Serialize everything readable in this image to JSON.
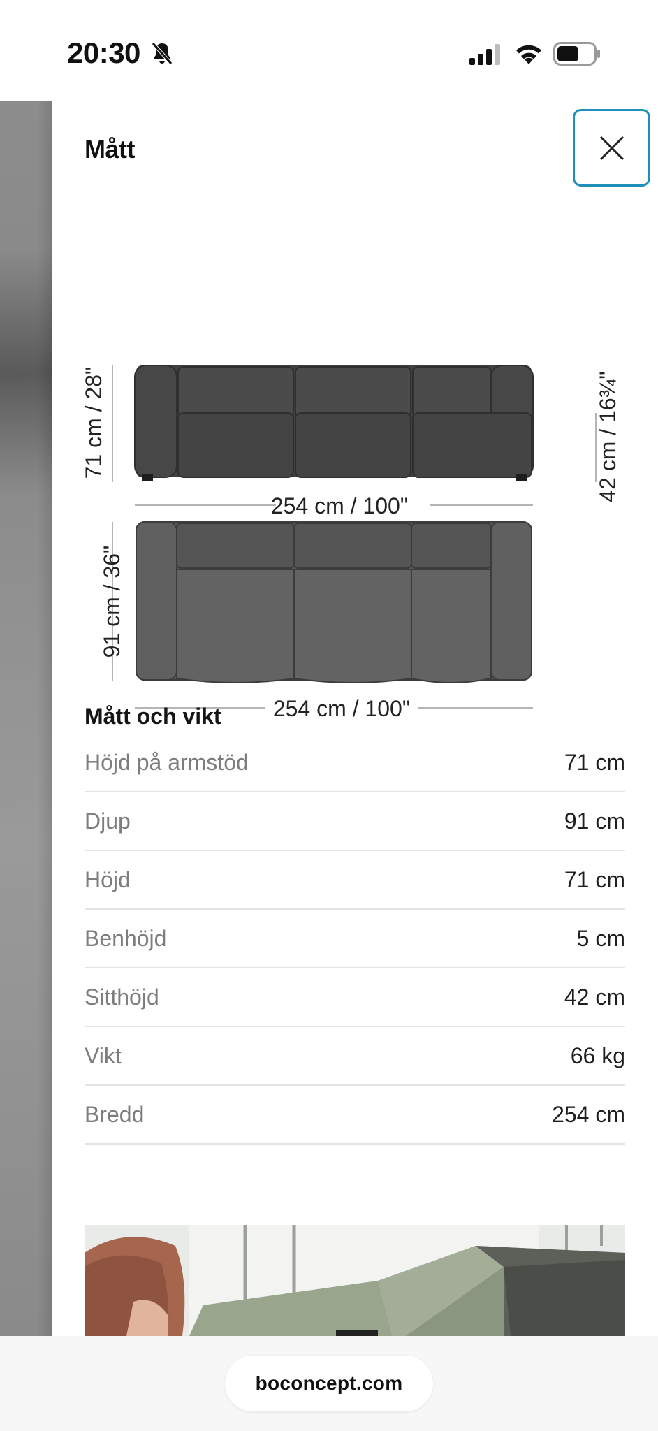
{
  "status_bar": {
    "time": "20:30",
    "icons": [
      "bell-slash-icon",
      "cellular-signal-icon",
      "wifi-icon",
      "battery-icon"
    ]
  },
  "panel": {
    "title": "Mått",
    "close_icon": "close-icon",
    "accent_color": "#1e8fb8"
  },
  "diagram": {
    "front_height": "71 cm / 28\"",
    "seat_height": "42 cm / 16¾\"",
    "front_width": "254 cm / 100\"",
    "top_depth": "91 cm / 36\"",
    "top_width": "254 cm / 100\"",
    "sofa_color": "#4a4a4a"
  },
  "specs": {
    "title": "Mått och vikt",
    "rows": [
      {
        "label": "Höjd på armstöd",
        "value": "71 cm"
      },
      {
        "label": "Djup",
        "value": "91 cm"
      },
      {
        "label": "Höjd",
        "value": "71 cm"
      },
      {
        "label": "Benhöjd",
        "value": "5 cm"
      },
      {
        "label": "Sitthöjd",
        "value": "42 cm"
      },
      {
        "label": "Vikt",
        "value": "66 kg"
      },
      {
        "label": "Bredd",
        "value": "254 cm"
      }
    ]
  },
  "browser": {
    "url": "boconcept.com"
  }
}
